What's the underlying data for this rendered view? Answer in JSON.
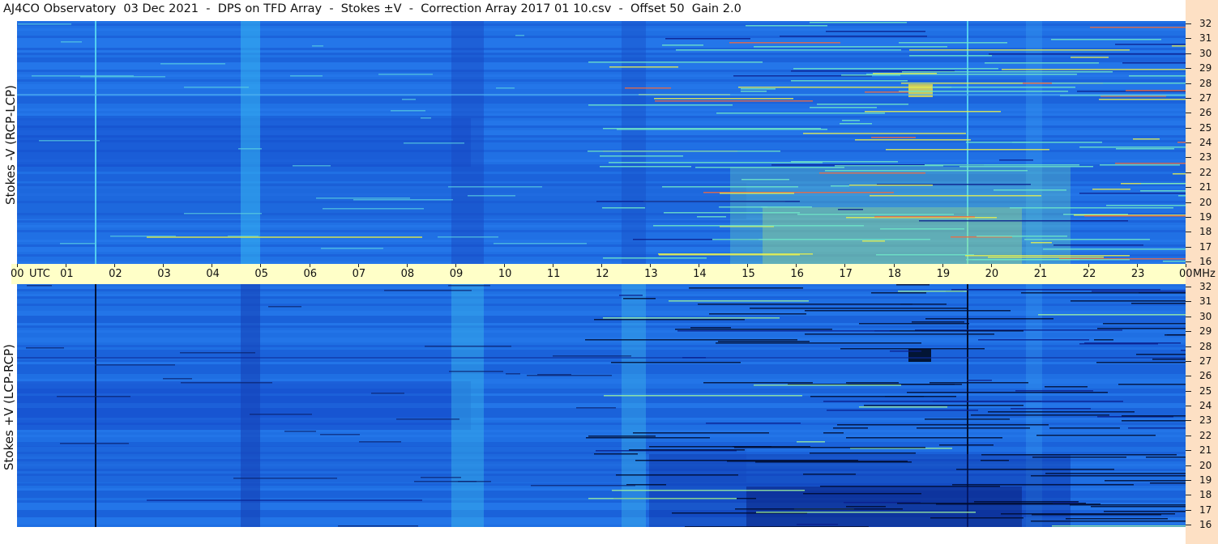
{
  "title": "AJ4CO Observatory  03 Dec 2021  -  DPS on TFD Array  -  Stokes ±V  -  Correction Array 2017 01 10.csv  -  Offset 50  Gain 2.0",
  "chart_data": [
    {
      "type": "heatmap",
      "panel": "top",
      "ylabel": "Stokes -V (RCP-LCP)",
      "x_ticks": [
        "00",
        "01",
        "02",
        "03",
        "04",
        "05",
        "06",
        "07",
        "08",
        "09",
        "10",
        "11",
        "12",
        "13",
        "14",
        "15",
        "16",
        "17",
        "18",
        "19",
        "20",
        "21",
        "22",
        "23",
        "00"
      ],
      "x_unit": "UTC",
      "y_ticks": [
        16,
        17,
        18,
        19,
        20,
        21,
        22,
        23,
        24,
        25,
        26,
        27,
        28,
        29,
        30,
        31,
        32
      ],
      "y_unit": "MHz",
      "xlim": [
        0,
        24
      ],
      "ylim": [
        16,
        32
      ],
      "colormap": [
        "#0a1f8c",
        "#1447d6",
        "#1e6fe8",
        "#2ea0f0",
        "#41d0e8",
        "#9cf07a",
        "#f2f040",
        "#f06030"
      ],
      "background_color": "#1e6be2"
    },
    {
      "type": "heatmap",
      "panel": "bottom",
      "ylabel": "Stokes +V (LCP-RCP)",
      "x_ticks": [
        "00",
        "01",
        "02",
        "03",
        "04",
        "05",
        "06",
        "07",
        "08",
        "09",
        "10",
        "11",
        "12",
        "13",
        "14",
        "15",
        "16",
        "17",
        "18",
        "19",
        "20",
        "21",
        "22",
        "23",
        "00"
      ],
      "x_unit": "UTC",
      "y_ticks": [
        16,
        17,
        18,
        19,
        20,
        21,
        22,
        23,
        24,
        25,
        26,
        27,
        28,
        29,
        30,
        31,
        32
      ],
      "y_unit": "MHz",
      "xlim": [
        0,
        24
      ],
      "ylim": [
        16,
        32
      ],
      "colormap": [
        "#000814",
        "#0a1f8c",
        "#1447d6",
        "#1e6fe8",
        "#2ea0f0",
        "#41d0e8"
      ],
      "background_color": "#1c68df"
    }
  ],
  "axis": {
    "utc_label": "UTC",
    "mhz_label": "MHz"
  },
  "colors": {
    "time_axis_bg": "#ffffc8",
    "freq_axis_bg": "#fde0c4"
  }
}
